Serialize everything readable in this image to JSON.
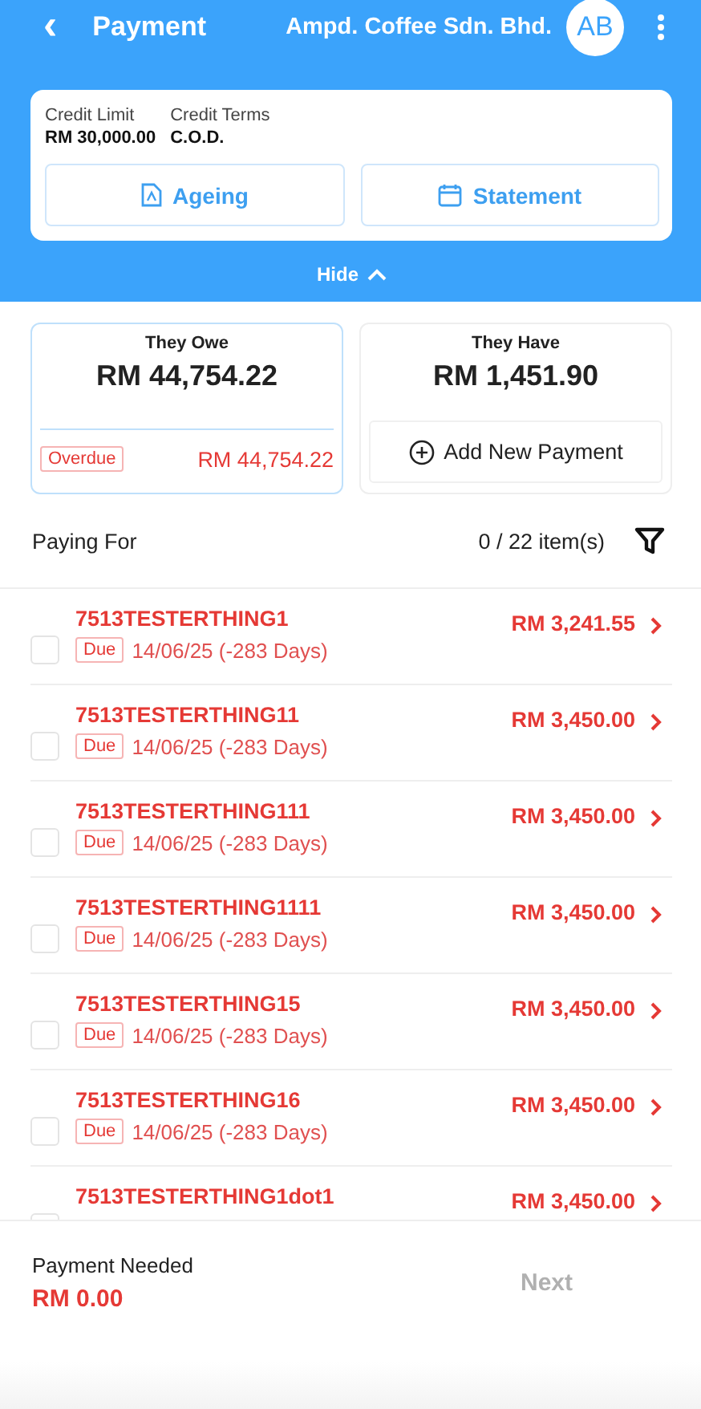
{
  "header": {
    "back": "‹",
    "title": "Payment",
    "company": "Ampd. Coffee Sdn. Bhd.",
    "avatar": "AB"
  },
  "credit": {
    "fields": [
      {
        "label": "Credit Limit",
        "value": "RM 30,000.00"
      },
      {
        "label": "Credit Terms",
        "value": "C.O.D."
      }
    ],
    "buttons": [
      {
        "kind": "pdf",
        "label": "Ageing"
      },
      {
        "kind": "calendar",
        "label": "Statement"
      }
    ]
  },
  "toggle": {
    "label": "Hide",
    "expanded": true
  },
  "owe": {
    "title": "They Owe",
    "amount": "RM 44,754.22",
    "tag": "Overdue",
    "overdue": "RM 44,754.22"
  },
  "have": {
    "title": "They Have",
    "amount": "RM 1,451.90",
    "action": "Add New Payment"
  },
  "paying": {
    "label": "Paying For",
    "count": "0 / 22 item(s)"
  },
  "items": [
    {
      "name": "7513TESTERTHING1",
      "amount": "RM 3,241.55",
      "tag": "Due",
      "date": "14/06/25 (-283 Days)",
      "checked": false
    },
    {
      "name": "7513TESTERTHING11",
      "amount": "RM 3,450.00",
      "tag": "Due",
      "date": "14/06/25 (-283 Days)",
      "checked": false
    },
    {
      "name": "7513TESTERTHING111",
      "amount": "RM 3,450.00",
      "tag": "Due",
      "date": "14/06/25 (-283 Days)",
      "checked": false
    },
    {
      "name": "7513TESTERTHING1111",
      "amount": "RM 3,450.00",
      "tag": "Due",
      "date": "14/06/25 (-283 Days)",
      "checked": false
    },
    {
      "name": "7513TESTERTHING15",
      "amount": "RM 3,450.00",
      "tag": "Due",
      "date": "14/06/25 (-283 Days)",
      "checked": false
    },
    {
      "name": "7513TESTERTHING16",
      "amount": "RM 3,450.00",
      "tag": "Due",
      "date": "14/06/25 (-283 Days)",
      "checked": false
    },
    {
      "name": "7513TESTERTHING1dot1",
      "amount": "RM 3,450.00",
      "checked": false
    }
  ],
  "footer": {
    "label": "Payment Needed",
    "amount": "RM 0.00",
    "next": {
      "label": "Next",
      "disabled": true
    }
  }
}
